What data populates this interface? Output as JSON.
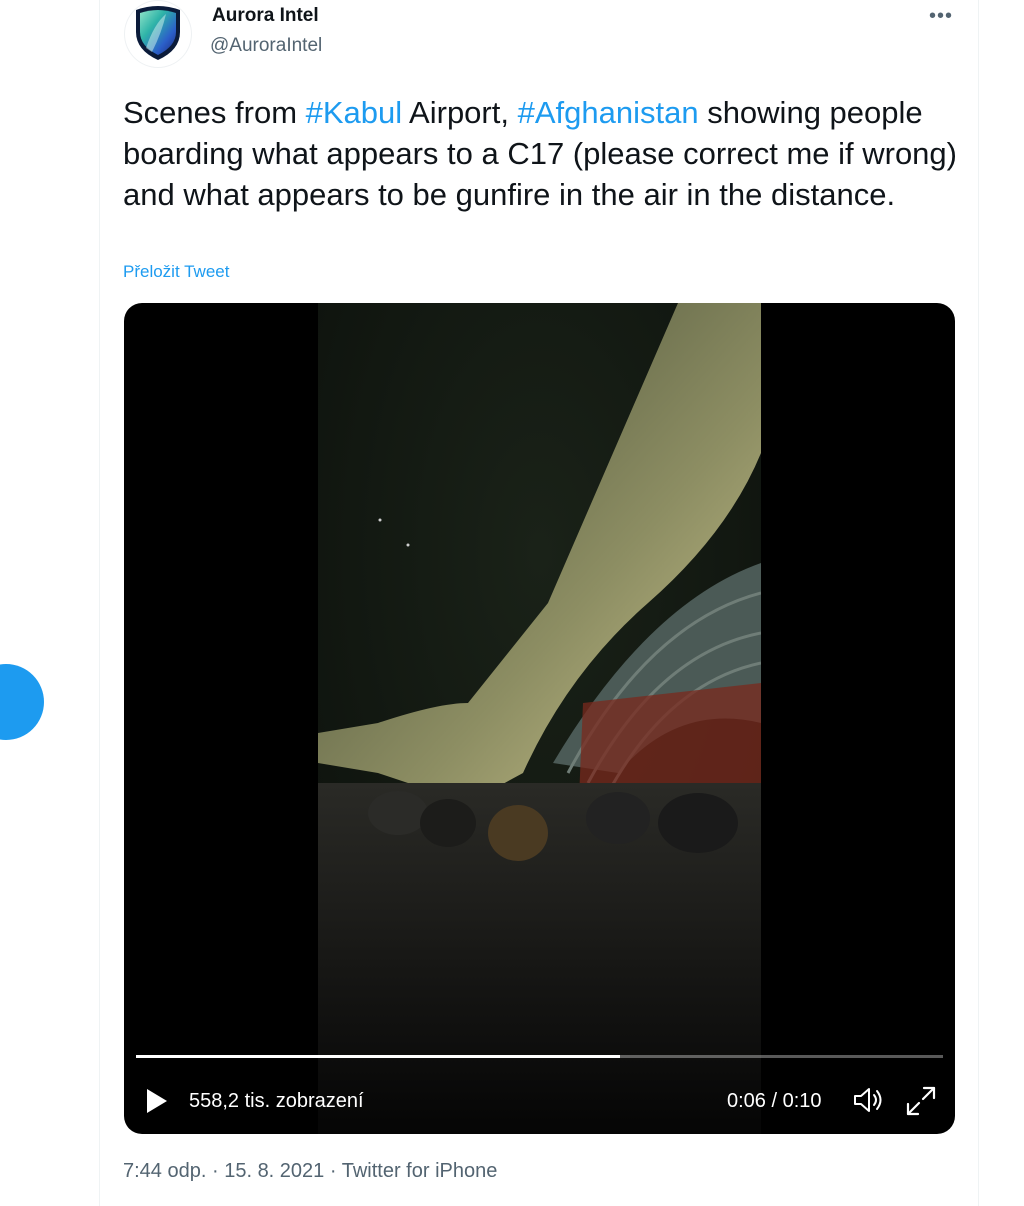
{
  "author": {
    "name": "Aurora Intel",
    "handle": "@AuroraIntel"
  },
  "more_menu": {
    "label": "•••"
  },
  "tweet": {
    "text_parts": [
      "Scenes from ",
      "#Kabul",
      " Airport, ",
      "#Afghanistan",
      " showing people boarding what appears to a C17 (please correct me if wrong) and what appears to be gunfire in the air in the distance."
    ],
    "translate_label": "Přeložit Tweet"
  },
  "video": {
    "views": "558,2 tis. zobrazení",
    "time": "0:06 / 0:10",
    "progress": 0.6
  },
  "meta": {
    "time": "7:44 odp.",
    "separator": " · ",
    "date": "15. 8. 2021",
    "source": "Twitter for iPhone"
  },
  "colors": {
    "accent": "#1d9bf0",
    "text": "#0f1419",
    "secondary": "#536471"
  },
  "icons": {
    "more": "more-horizontal-icon",
    "play": "play-icon",
    "volume": "volume-icon",
    "fullscreen": "fullscreen-icon",
    "avatar": "shield-logo-icon"
  }
}
